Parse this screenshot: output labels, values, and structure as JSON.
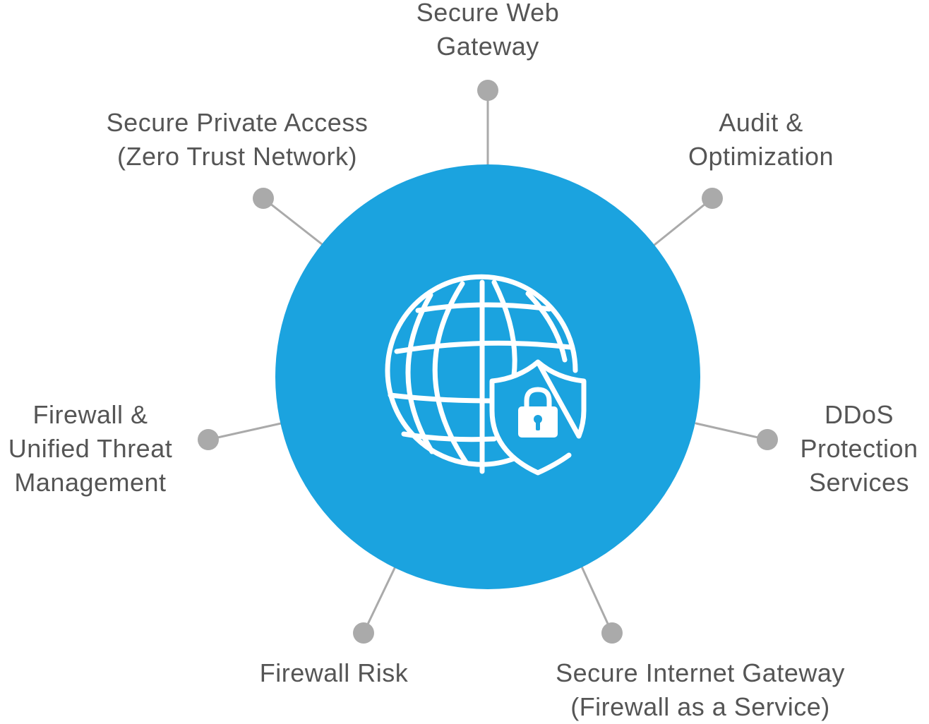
{
  "diagram": {
    "colors": {
      "hub": "#1ba3df",
      "connector": "#aaaaaa",
      "dot": "#aaaaaa",
      "icon": "#ffffff",
      "text": "#555555"
    },
    "hub_icon": "globe-shield-lock-icon",
    "services": {
      "secure_web_gateway": {
        "lines": [
          "Secure Web",
          "Gateway"
        ]
      },
      "secure_private_access": {
        "lines": [
          "Secure Private Access",
          "(Zero Trust Network)"
        ]
      },
      "audit_optimization": {
        "lines": [
          "Audit &",
          "Optimization"
        ]
      },
      "firewall_utm": {
        "lines": [
          "Firewall &",
          "Unified Threat",
          "Management"
        ]
      },
      "ddos": {
        "lines": [
          "DDoS",
          "Protection",
          "Services"
        ]
      },
      "firewall_risk": {
        "lines": [
          "Firewall Risk"
        ]
      },
      "secure_internet_gateway": {
        "lines": [
          "Secure Internet Gateway",
          "(Firewall as a Service)"
        ]
      }
    }
  }
}
